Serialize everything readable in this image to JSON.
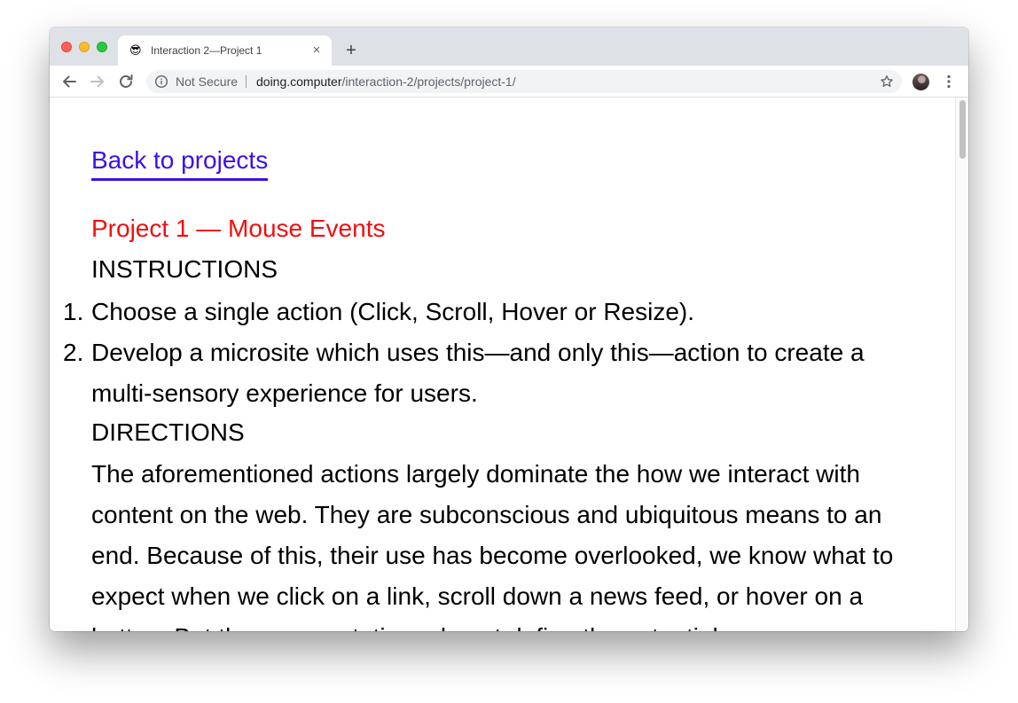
{
  "browser": {
    "tab": {
      "favicon": "😎",
      "title": "Interaction 2—Project 1",
      "close_symbol": "×"
    },
    "new_tab_symbol": "+",
    "security_label": "Not Secure",
    "url_host": "doing.computer",
    "url_path": "/interaction-2/projects/project-1/",
    "icons": [
      "back-arrow-icon",
      "forward-arrow-icon",
      "reload-icon",
      "info-icon",
      "star-icon",
      "profile-avatar",
      "kebab-menu-icon"
    ],
    "colors": {
      "tabstrip": "#dee1e6",
      "omnibox": "#f1f3f4"
    }
  },
  "page": {
    "back_link": "Back to projects",
    "project_title": "Project 1 — Mouse Events",
    "instructions_heading": "INSTRUCTIONS",
    "instructions": [
      {
        "num": "1.",
        "text": "Choose a single action (Click, Scroll, Hover or Resize)."
      },
      {
        "num": "2.",
        "text": "Develop a microsite which uses this—and only this—action to create a multi-sensory experience for users."
      }
    ],
    "directions_heading": "DIRECTIONS",
    "directions_text": "The aforementioned actions largely dominate the how we interact with content on the web. They are subconscious and ubiquitous means to an end. Because of this, their use has become overlooked, we know what to expect when we click on a link, scroll down a news feed, or hover on a button. But these expectations do not define the potential",
    "colors": {
      "link": "#3c10e8",
      "title": "#f20d0d",
      "text": "#000000"
    }
  }
}
